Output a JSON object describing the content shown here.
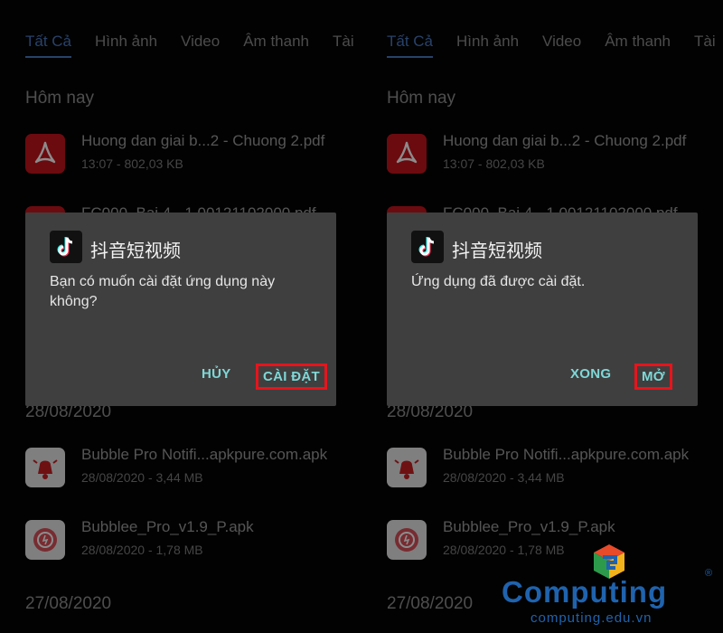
{
  "panels": [
    {
      "tabs": [
        "Tất Cả",
        "Hình ảnh",
        "Video",
        "Âm thanh",
        "Tài"
      ],
      "sections": {
        "today": "Hôm nay",
        "date1": "28/08/2020",
        "date2": "27/08/2020"
      },
      "files": [
        {
          "name": "Huong dan giai b...2 - Chuong 2.pdf",
          "meta": "13:07 - 802,03 KB",
          "icon": "pdf-icon"
        },
        {
          "name": "FC000_Bai 4 - 1 00121102000.pdf",
          "meta": "",
          "icon": "pdf-icon"
        },
        {
          "name": "Bubble Pro Notifi...apkpure.com.apk",
          "meta": "28/08/2020 - 3,44 MB",
          "icon": "bell-icon"
        },
        {
          "name": "Bubblee_Pro_v1.9_P.apk",
          "meta": "28/08/2020 - 1,78 MB",
          "icon": "bubble-icon"
        }
      ],
      "dialog": {
        "title": "抖音短视频",
        "message": "Bạn có muốn cài đặt ứng dụng này không?",
        "negative": "HỦY",
        "positive": "CÀI ĐẶT"
      }
    },
    {
      "tabs": [
        "Tất Cả",
        "Hình ảnh",
        "Video",
        "Âm thanh",
        "Tài"
      ],
      "sections": {
        "today": "Hôm nay",
        "date1": "28/08/2020",
        "date2": "27/08/2020"
      },
      "files": [
        {
          "name": "Huong dan giai b...2 - Chuong 2.pdf",
          "meta": "13:07 - 802,03 KB",
          "icon": "pdf-icon"
        },
        {
          "name": "FC000_Bai 4 - 1 00121102000.pdf",
          "meta": "",
          "icon": "pdf-icon"
        },
        {
          "name": "Bubble Pro Notifi...apkpure.com.apk",
          "meta": "28/08/2020 - 3,44 MB",
          "icon": "bell-icon"
        },
        {
          "name": "Bubblee_Pro_v1.9_P.apk",
          "meta": "28/08/2020 - 1,78 MB",
          "icon": "bubble-icon"
        }
      ],
      "dialog": {
        "title": "抖音短视频",
        "message": "Ứng dụng đã được cài đặt.",
        "negative": "XONG",
        "positive": "MỞ"
      }
    }
  ],
  "watermark": {
    "word": "Computing",
    "reg": "®",
    "url": "computing.edu.vn"
  },
  "colors": {
    "accent": "#4a78c2",
    "highlight": "#e8141b",
    "button_text": "#7fd7d7",
    "brand": "#1f63ae"
  }
}
